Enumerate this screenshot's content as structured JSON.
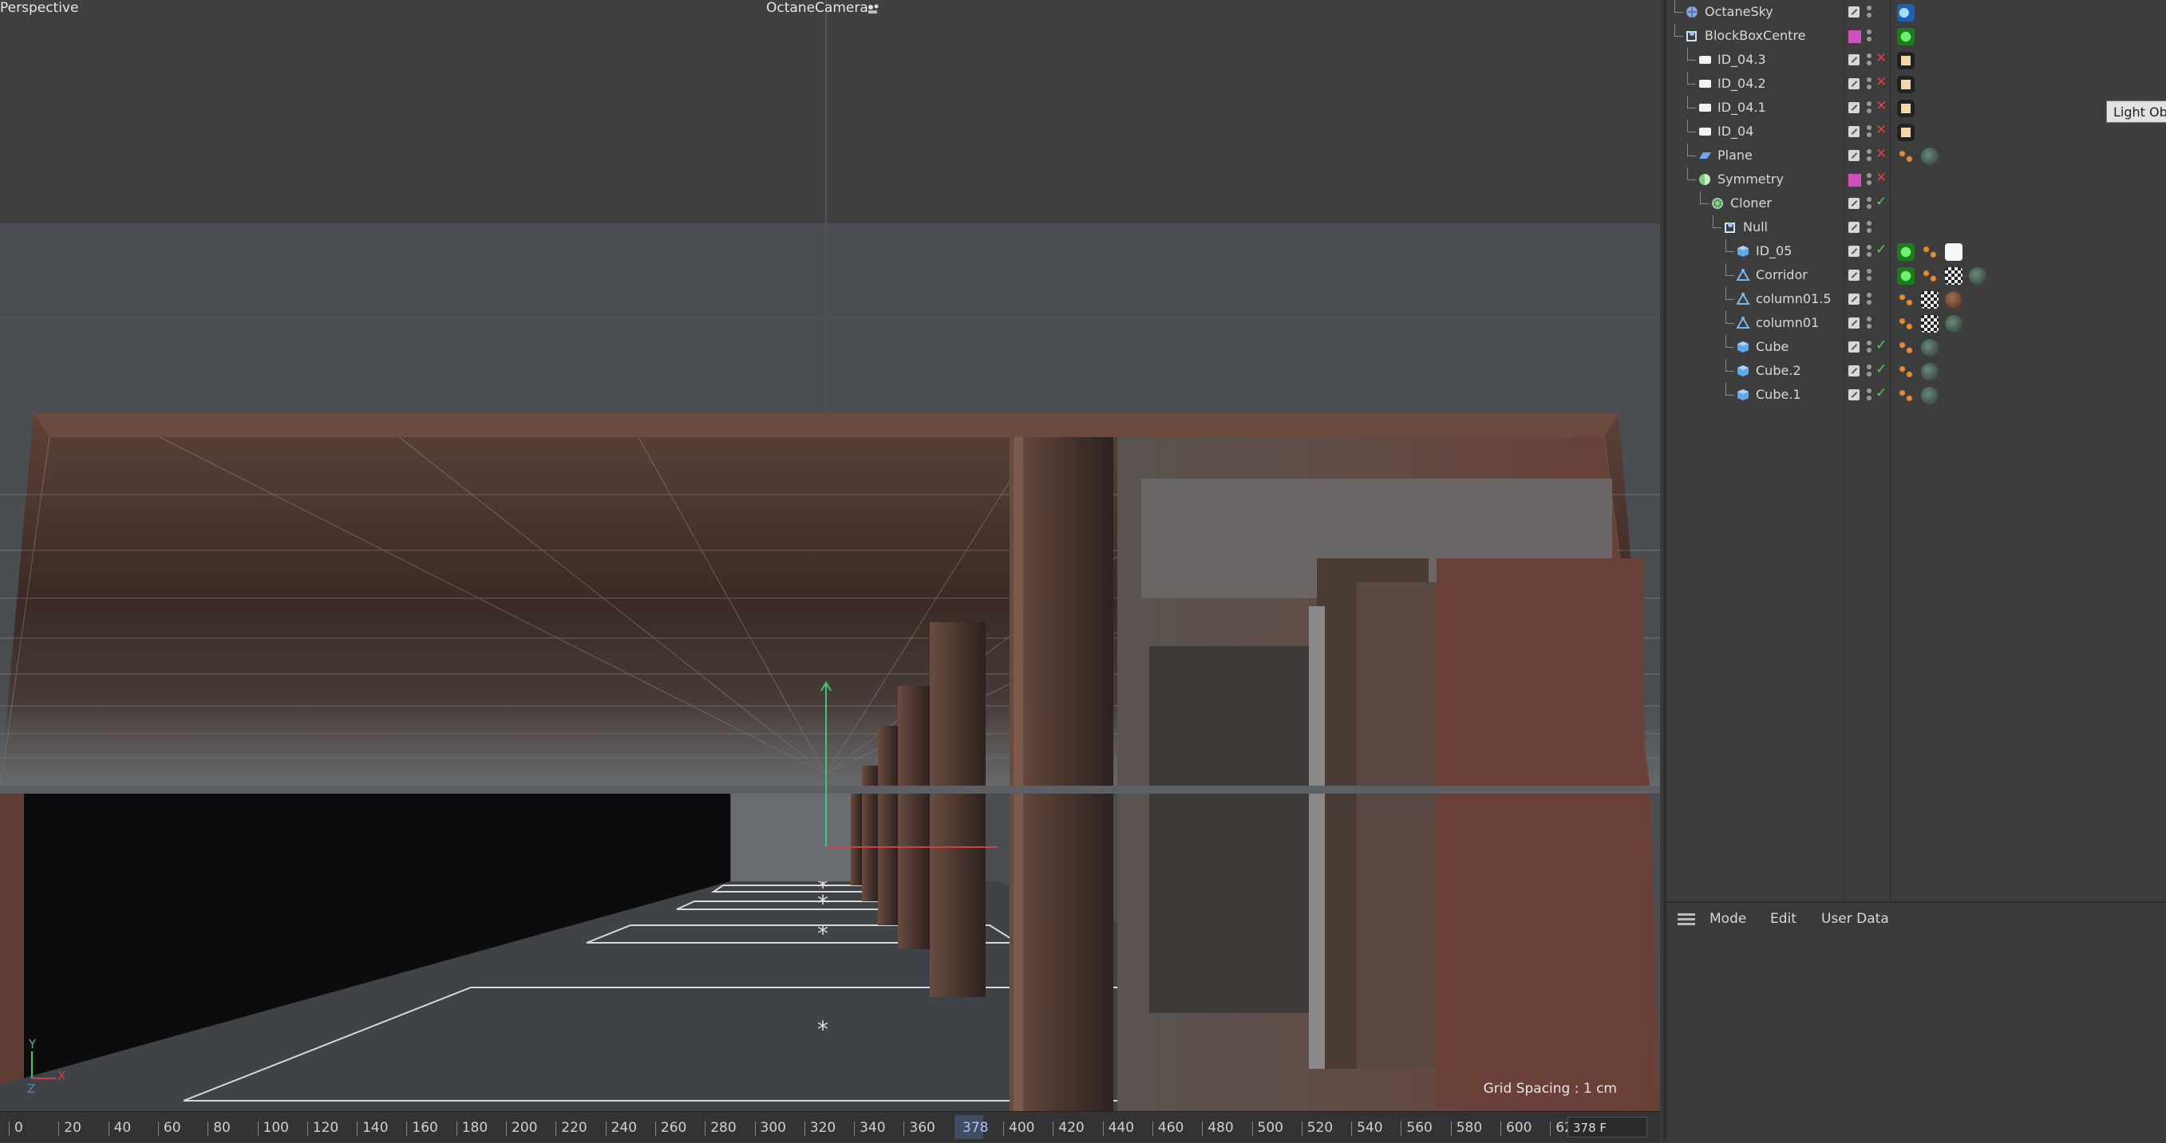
{
  "viewport": {
    "view_name": "Perspective",
    "camera_name": "OctaneCamera",
    "grid_spacing": "Grid Spacing : 1 cm",
    "axis_x": "X",
    "axis_y": "Y",
    "axis_z": "Z",
    "camera_icon": "camera-link-icon"
  },
  "timeline": {
    "ticks": [
      "0",
      "20",
      "40",
      "60",
      "80",
      "100",
      "120",
      "140",
      "160",
      "180",
      "200",
      "220",
      "240",
      "260",
      "280",
      "300",
      "320",
      "340",
      "360",
      "400",
      "420",
      "440",
      "460",
      "480",
      "500",
      "520",
      "540",
      "560",
      "580",
      "600",
      "62"
    ],
    "current_frame": "378",
    "frame_field": "378 F"
  },
  "object_manager": {
    "objects": [
      {
        "name": "OctaneSky",
        "icon": "sky-icon",
        "depth": 0,
        "edit": true,
        "swatch": false,
        "flag": "",
        "tags": [
          "octane-env-tag-icon"
        ]
      },
      {
        "name": "BlockBoxCentre",
        "icon": "null-icon",
        "depth": 0,
        "edit": false,
        "swatch": true,
        "flag": "",
        "tags": [
          "octane-object-tag-icon"
        ]
      },
      {
        "name": "ID_04.3",
        "icon": "light-icon",
        "depth": 1,
        "edit": true,
        "swatch": false,
        "flag": "x",
        "tags": [
          "octane-light-tag-icon"
        ]
      },
      {
        "name": "ID_04.2",
        "icon": "light-icon",
        "depth": 1,
        "edit": true,
        "swatch": false,
        "flag": "x",
        "tags": [
          "octane-light-tag-icon"
        ]
      },
      {
        "name": "ID_04.1",
        "icon": "light-icon",
        "depth": 1,
        "edit": true,
        "swatch": false,
        "flag": "x",
        "tags": [
          "octane-light-tag-icon"
        ]
      },
      {
        "name": "ID_04",
        "icon": "light-icon",
        "depth": 1,
        "edit": true,
        "swatch": false,
        "flag": "x",
        "tags": [
          "octane-light-tag-icon"
        ]
      },
      {
        "name": "Plane",
        "icon": "plane-icon",
        "depth": 1,
        "edit": true,
        "swatch": false,
        "flag": "x",
        "tags": [
          "texture-tag-icon",
          "material-tag-icon"
        ]
      },
      {
        "name": "Symmetry",
        "icon": "symmetry-icon",
        "depth": 1,
        "edit": false,
        "swatch": true,
        "flag": "x",
        "tags": []
      },
      {
        "name": "Cloner",
        "icon": "cloner-icon",
        "depth": 2,
        "edit": true,
        "swatch": false,
        "flag": "ok",
        "tags": []
      },
      {
        "name": "Null",
        "icon": "null-icon",
        "depth": 3,
        "edit": true,
        "swatch": false,
        "flag": "",
        "tags": []
      },
      {
        "name": "ID_05",
        "icon": "cube-icon",
        "depth": 4,
        "edit": true,
        "swatch": false,
        "flag": "ok",
        "tags": [
          "octane-object-tag-icon",
          "texture-tag-icon",
          "white-material-tag-icon"
        ]
      },
      {
        "name": "Corridor",
        "icon": "polygon-icon",
        "depth": 4,
        "edit": true,
        "swatch": false,
        "flag": "",
        "tags": [
          "octane-object-tag-icon",
          "texture-tag-icon",
          "checker-material-tag-icon",
          "material-tag-icon"
        ]
      },
      {
        "name": "column01.5",
        "icon": "polygon-icon",
        "depth": 4,
        "edit": true,
        "swatch": false,
        "flag": "",
        "tags": [
          "texture-tag-icon",
          "checker-material-tag-icon",
          "rust-material-tag-icon"
        ]
      },
      {
        "name": "column01",
        "icon": "polygon-icon",
        "depth": 4,
        "edit": true,
        "swatch": false,
        "flag": "",
        "tags": [
          "texture-tag-icon",
          "checker-material-tag-icon",
          "material-tag-icon"
        ]
      },
      {
        "name": "Cube",
        "icon": "cube-icon",
        "depth": 4,
        "edit": true,
        "swatch": false,
        "flag": "ok",
        "tags": [
          "texture-tag-icon",
          "material-tag-icon"
        ]
      },
      {
        "name": "Cube.2",
        "icon": "cube-icon",
        "depth": 4,
        "edit": true,
        "swatch": false,
        "flag": "ok",
        "tags": [
          "texture-tag-icon",
          "material-tag-icon"
        ]
      },
      {
        "name": "Cube.1",
        "icon": "cube-icon",
        "depth": 4,
        "edit": true,
        "swatch": false,
        "flag": "ok",
        "tags": [
          "texture-tag-icon",
          "material-tag-icon"
        ]
      }
    ],
    "tooltip": "Light Obje"
  },
  "attribute_manager": {
    "menu": [
      "Mode",
      "Edit",
      "User Data"
    ]
  },
  "colors": {
    "swatch": "#d04fbf",
    "accent": "#5a7dc0"
  }
}
